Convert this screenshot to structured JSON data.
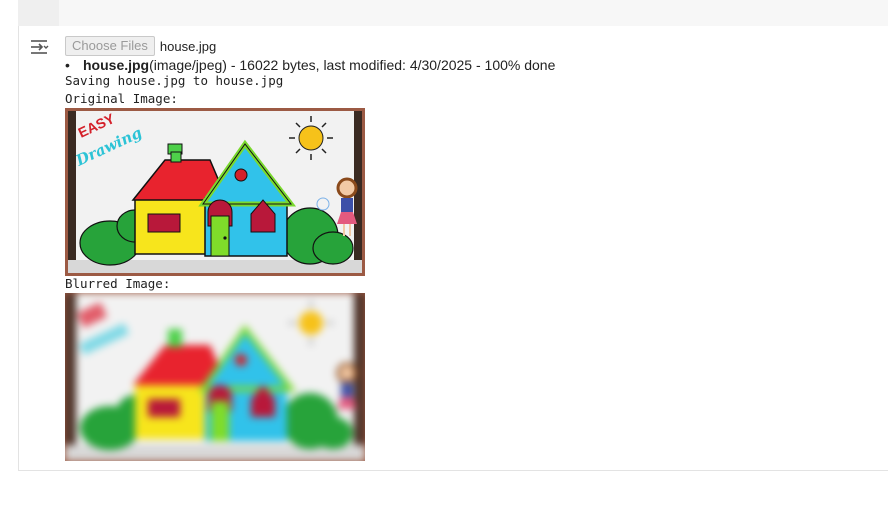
{
  "upload": {
    "button_label": "Choose Files",
    "chosen_file": "house.jpg"
  },
  "file_info": {
    "name": "house.jpg",
    "details": "(image/jpeg) - 16022 bytes, last modified: 4/30/2025 - 100% done"
  },
  "output": {
    "saving_line": "Saving house.jpg to house.jpg",
    "original_label": "Original Image:",
    "blurred_label": "Blurred Image:"
  },
  "image": {
    "logo_line1": "EASY",
    "logo_line2": "Drawing"
  },
  "icons": {
    "output_toggle": "output-collapse-icon"
  }
}
